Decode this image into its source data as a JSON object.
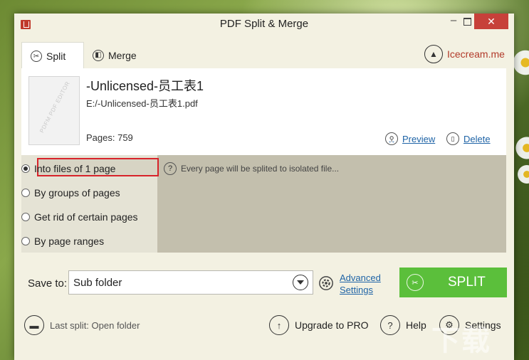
{
  "window": {
    "title": "PDF Split & Merge",
    "minimize": "–",
    "close": "✕"
  },
  "tabs": [
    {
      "label": "Split",
      "icon": "scissors-icon",
      "active": true
    },
    {
      "label": "Merge",
      "icon": "merge-icon",
      "active": false
    }
  ],
  "brand": {
    "label": "Icecream.me",
    "icon": "icecream-logo-icon"
  },
  "file": {
    "thumbnail_text": "PDFM PDF EDITOR",
    "name": "-Unlicensed-员工表1",
    "path": "E:/-Unlicensed-员工表1.pdf",
    "pages": "Pages: 759",
    "preview_label": "Preview",
    "delete_label": "Delete"
  },
  "options": [
    {
      "label": "Into files of 1 page",
      "selected": true
    },
    {
      "label": "By groups of pages",
      "selected": false
    },
    {
      "label": "Get rid of certain pages",
      "selected": false
    },
    {
      "label": "By page ranges",
      "selected": false
    }
  ],
  "hint": {
    "icon": "question-icon",
    "text": "Every page will be splited to isolated file..."
  },
  "save": {
    "label": "Save to:",
    "value": "Sub folder",
    "advanced_line1": "Advanced",
    "advanced_line2": "Settings"
  },
  "split_button": {
    "label": "SPLIT"
  },
  "footer": {
    "last_split": "Last split: Open folder",
    "upgrade": "Upgrade to PRO",
    "help": "Help",
    "settings": "Settings"
  },
  "watermark": "下载",
  "colors": {
    "accent_red": "#d8232a",
    "split_green": "#5bbf3b",
    "link_blue": "#1e63a6",
    "close_red": "#c7413a"
  }
}
